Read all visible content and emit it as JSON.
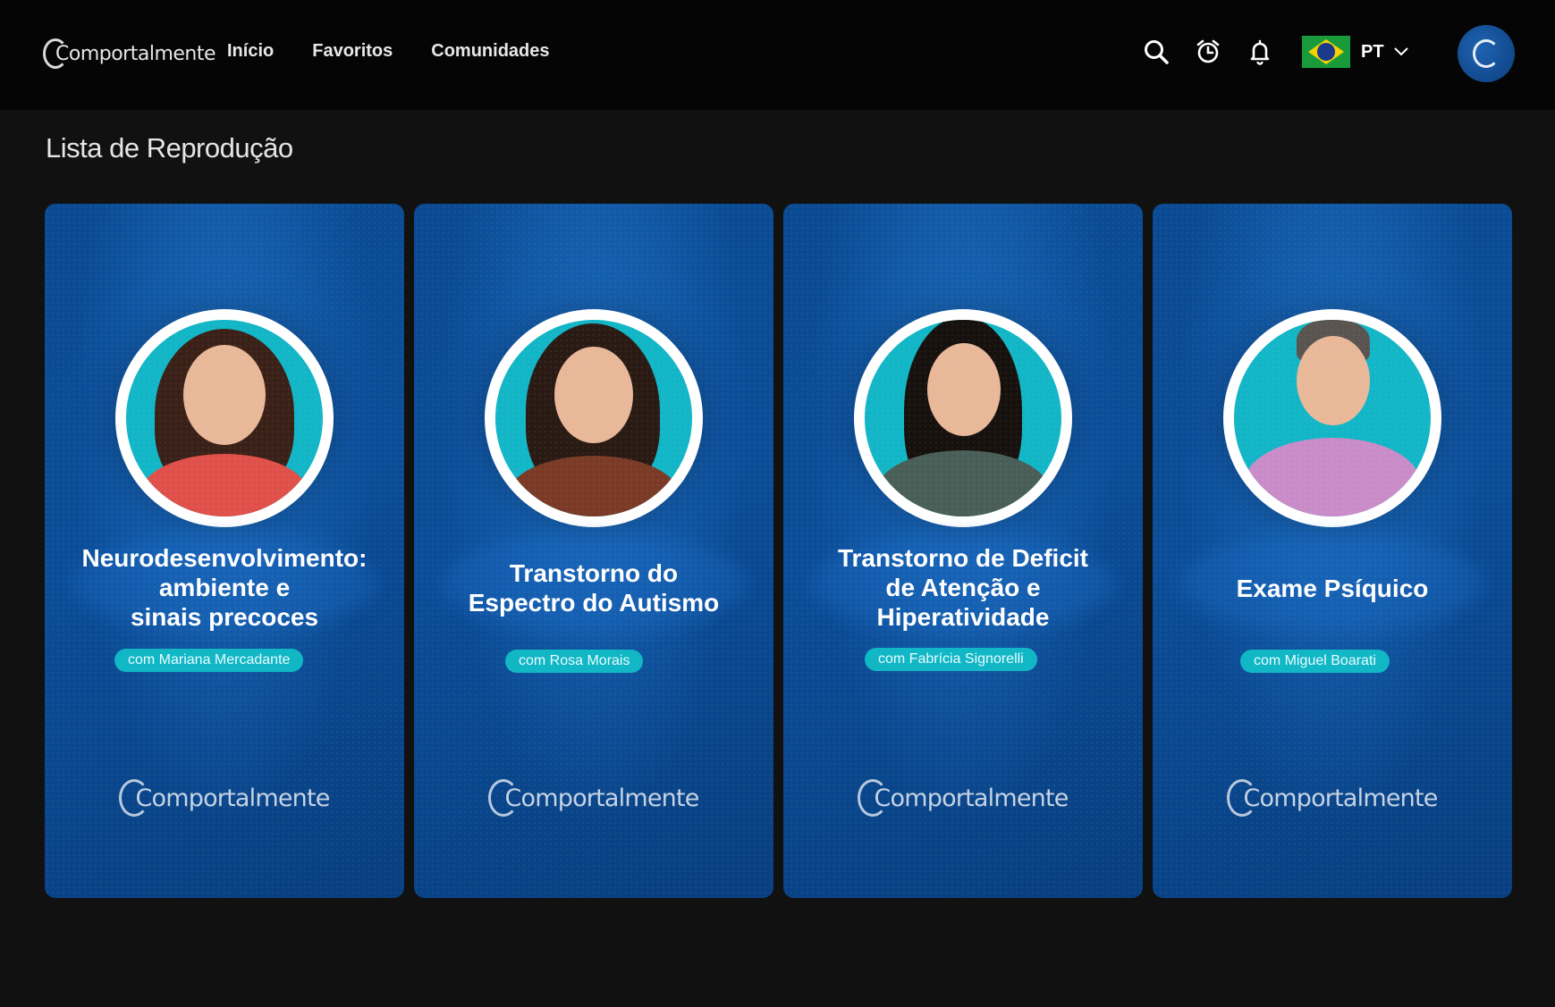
{
  "header": {
    "logo_text": "Comportalmente",
    "nav": [
      {
        "label": "Início"
      },
      {
        "label": "Favoritos"
      },
      {
        "label": "Comunidades"
      }
    ],
    "language": "PT",
    "icons": [
      "search-icon",
      "alarm-clock-icon",
      "bell-icon",
      "brazil-flag-icon",
      "chevron-down-icon"
    ]
  },
  "page": {
    "title": "Lista de Reprodução"
  },
  "cards": [
    {
      "title_lines": [
        "Neurodesenvolvimento:",
        "ambiente e",
        "sinais precoces"
      ],
      "presenter": "com Mariana Mercadante",
      "logo_text": "Comportalmente"
    },
    {
      "title_lines": [
        "Transtorno do",
        "Espectro do Autismo"
      ],
      "presenter": "com Rosa Morais",
      "logo_text": "Comportalmente"
    },
    {
      "title_lines": [
        "Transtorno de Deficit",
        "de Atenção e",
        "Hiperatividade"
      ],
      "presenter": "com Fabrícia Signorelli",
      "logo_text": "Comportalmente"
    },
    {
      "title_lines": [
        "Exame Psíquico"
      ],
      "presenter": "com Miguel Boarati",
      "logo_text": "Comportalmente"
    }
  ],
  "colors": {
    "background": "#111111",
    "header": "#050505",
    "card_blue": "#0a4a92",
    "accent_teal": "#11b7c5"
  }
}
